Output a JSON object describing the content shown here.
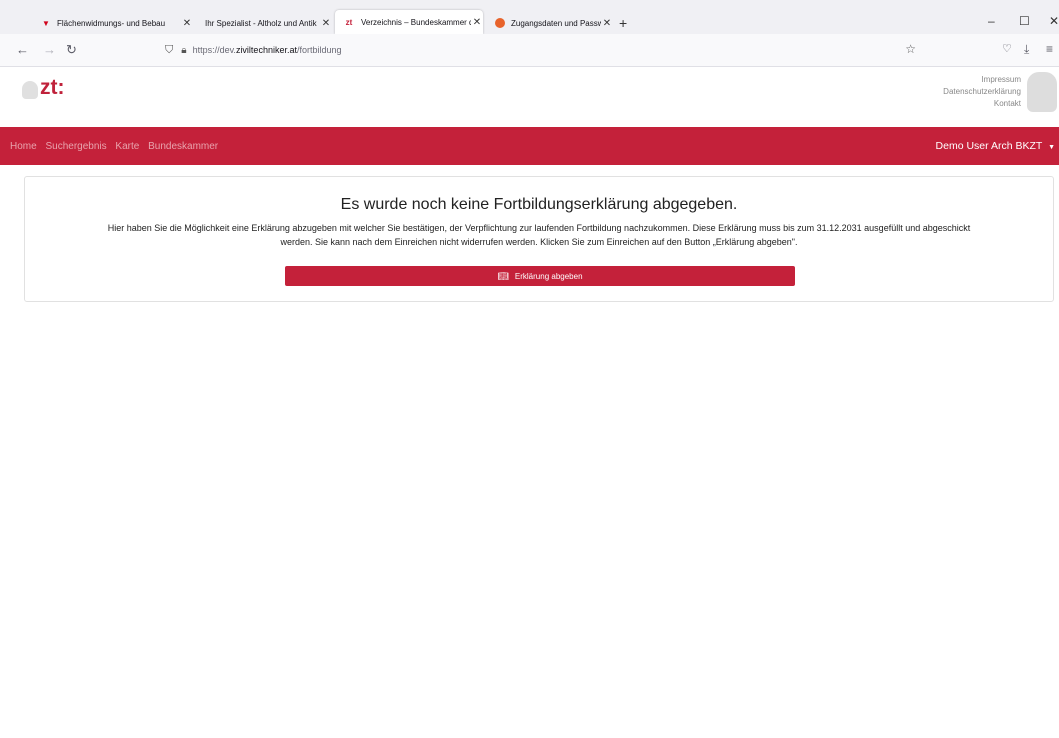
{
  "browser": {
    "tabs": [
      {
        "title": "Flächenwidmungs- und Bebau",
        "close": "✕"
      },
      {
        "title": "Ihr Spezialist - Altholz und Antik",
        "close": "✕"
      },
      {
        "title": "Verzeichnis – Bundeskammer d",
        "close": "✕"
      },
      {
        "title": "Zugangsdaten und Passwörter",
        "close": "✕"
      }
    ],
    "new_tab": "+",
    "url_prefix": "https://dev.",
    "url_domain": "ziviltechniker.at",
    "url_path": "/fortbildung",
    "window_controls": [
      "–",
      "☐",
      "✕"
    ]
  },
  "site": {
    "logo_text": "zt:",
    "top_links": [
      "Impressum",
      "Datenschutzerklärung",
      "Kontakt"
    ],
    "nav_links": [
      "Home",
      "Suchergebnis",
      "Karte",
      "Bundeskammer"
    ],
    "user_menu": "Demo User Arch BKZT",
    "accent_color": "#c4213a"
  },
  "main": {
    "heading": "Es wurde noch keine Fortbildungserklärung abgegeben.",
    "text_line1": "Hier haben Sie die Möglichkeit eine Erklärung abzugeben mit welcher Sie bestätigen, der Verpflichtung zur laufenden Fortbildung nachzukommen. Diese Erklärung muss bis zum 31.12.2031 ausgefüllt und abgeschickt",
    "text_line2": "werden. Sie kann nach dem Einreichen nicht widerrufen werden. Klicken Sie zum Einreichen auf den Button „Erklärung abgeben\".",
    "button_label": "Erklärung abgeben",
    "button_icon": "book-icon"
  }
}
